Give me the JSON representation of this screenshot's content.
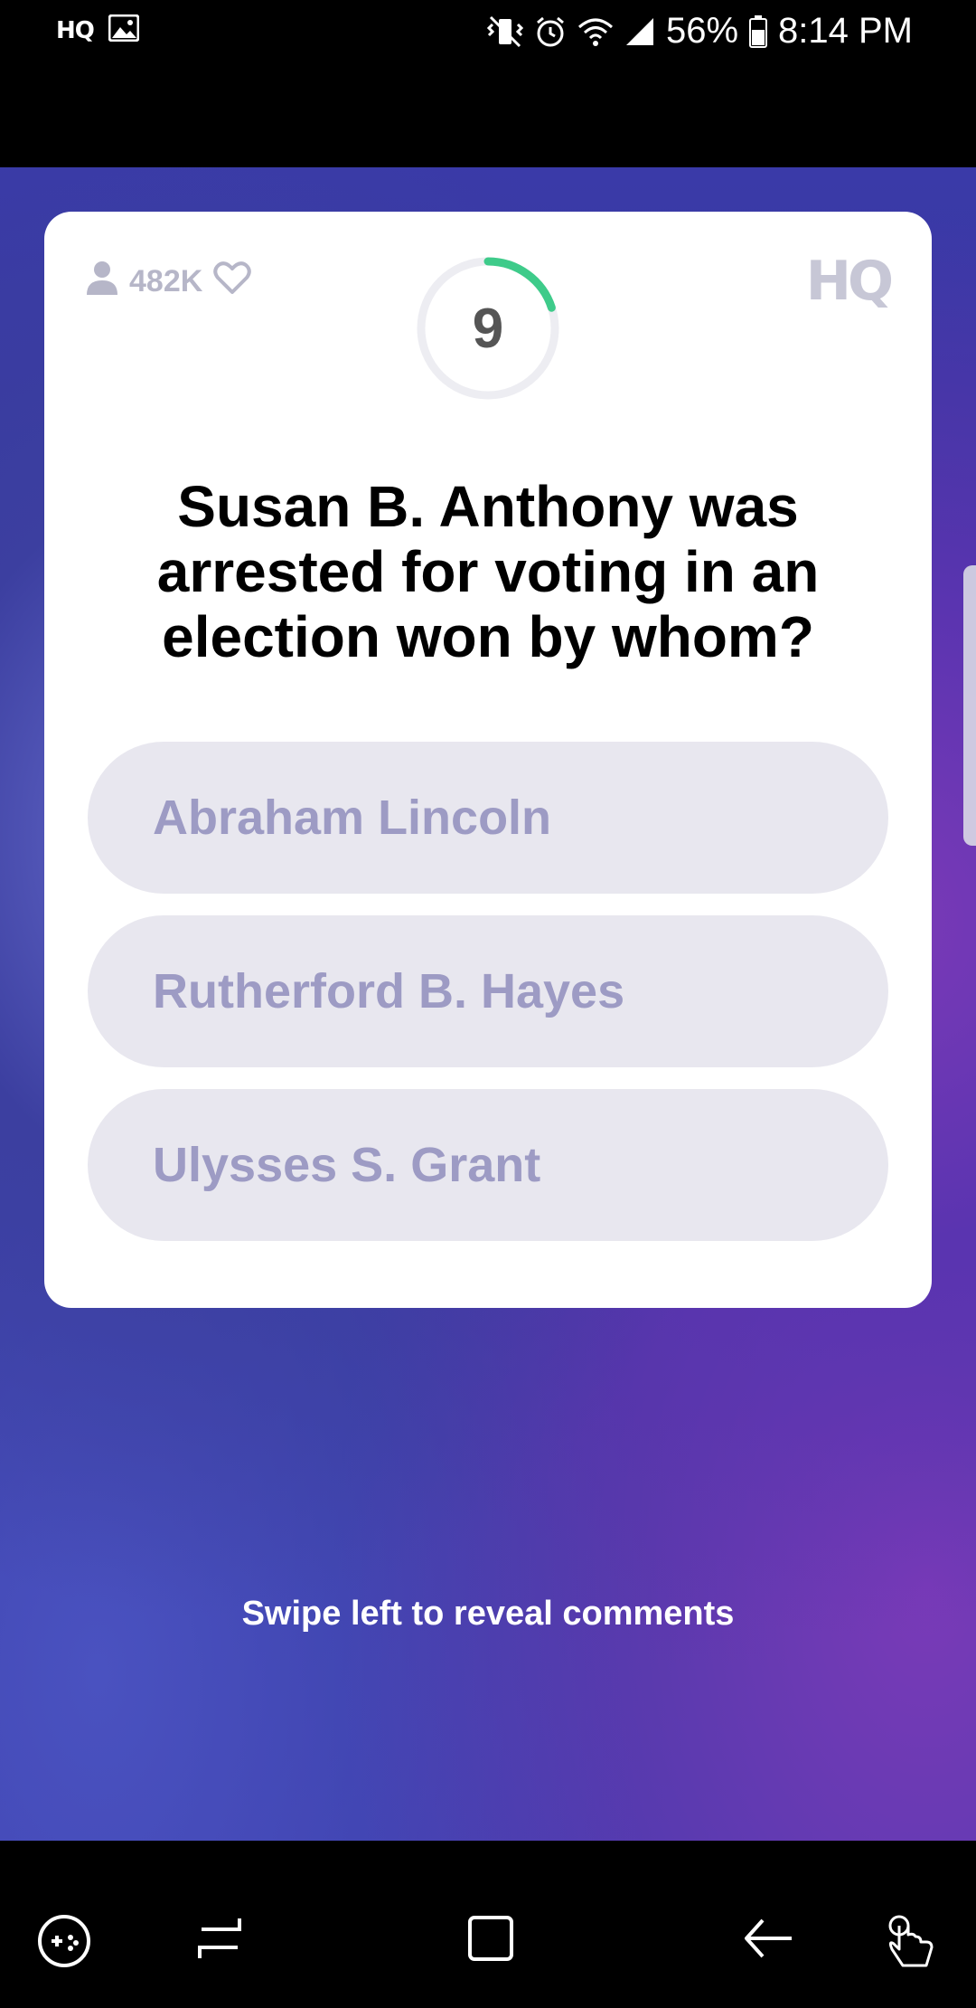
{
  "status_bar": {
    "left_app": "HQ",
    "battery": "56%",
    "time": "8:14 PM"
  },
  "game": {
    "viewers": "482K",
    "timer": "9",
    "timer_progress": 0.2,
    "logo": "HQ",
    "question": "Susan B. Anthony was arrested for voting in an election won by whom?",
    "answers": [
      {
        "label": "Abraham Lincoln"
      },
      {
        "label": "Rutherford B. Hayes"
      },
      {
        "label": "Ulysses S. Grant"
      }
    ],
    "swipe_hint": "Swipe left to reveal comments"
  },
  "colors": {
    "accent_green": "#3ecb8a",
    "answer_bg": "#e8e7ef",
    "answer_text": "#9d9bc4"
  },
  "nav_icons": [
    "game-tools-icon",
    "recent-apps-icon",
    "home-icon",
    "back-icon",
    "touch-gesture-icon"
  ]
}
